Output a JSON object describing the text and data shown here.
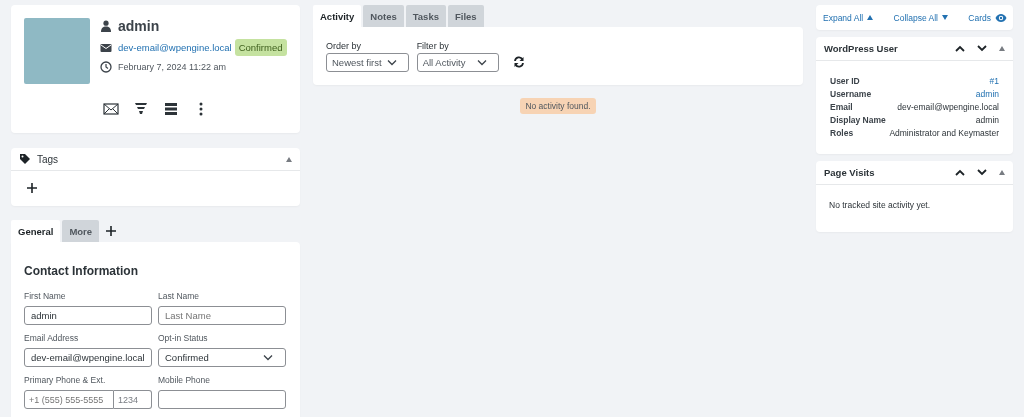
{
  "profile": {
    "name": "admin",
    "email": "dev-email@wpengine.local",
    "status": "Confirmed",
    "date": "February 7, 2024 11:22 am"
  },
  "tags": {
    "title": "Tags",
    "expanded": true
  },
  "contact_tabs": [
    {
      "label": "General",
      "selected": true
    },
    {
      "label": "More",
      "selected": false
    }
  ],
  "contact": {
    "heading": "Contact Information",
    "fields": [
      {
        "kind": "text",
        "label": "First Name",
        "value": "admin"
      },
      {
        "kind": "text",
        "label": "Last Name",
        "placeholder": "Last Name"
      },
      {
        "kind": "text",
        "label": "Email Address",
        "value": "dev-email@wpengine.local"
      },
      {
        "kind": "select",
        "label": "Opt-in Status",
        "value": "Confirmed"
      },
      {
        "kind": "phone",
        "label": "Primary Phone & Ext.",
        "placeholder": "+1 (555) 555-5555",
        "ext": "1234"
      },
      {
        "kind": "text",
        "label": "Mobile Phone"
      }
    ]
  },
  "activity_tabs": [
    {
      "label": "Activity",
      "selected": true
    },
    {
      "label": "Notes",
      "selected": false
    },
    {
      "label": "Tasks",
      "selected": false
    },
    {
      "label": "Files",
      "selected": false
    }
  ],
  "filters": [
    {
      "label": "Order by",
      "value": "Newest first"
    },
    {
      "label": "Filter by",
      "value": "All Activity"
    }
  ],
  "empty_message": "No activity found.",
  "toolbar": [
    {
      "kind": "expand",
      "label": "Expand All"
    },
    {
      "kind": "collapse",
      "label": "Collapse All"
    },
    {
      "kind": "cards",
      "label": "Cards"
    }
  ],
  "cards": [
    {
      "title": "WordPress User",
      "rows": [
        {
          "label": "User ID",
          "value": "#1",
          "link": true
        },
        {
          "label": "Username",
          "value": "admin",
          "link": true
        },
        {
          "label": "Email",
          "value": "dev-email@wpengine.local",
          "link": false
        },
        {
          "label": "Display Name",
          "value": "admin",
          "link": false
        },
        {
          "label": "Roles",
          "value": "Administrator and Keymaster",
          "link": false
        }
      ]
    },
    {
      "title": "Page Visits",
      "message": "No tracked site activity yet."
    }
  ]
}
